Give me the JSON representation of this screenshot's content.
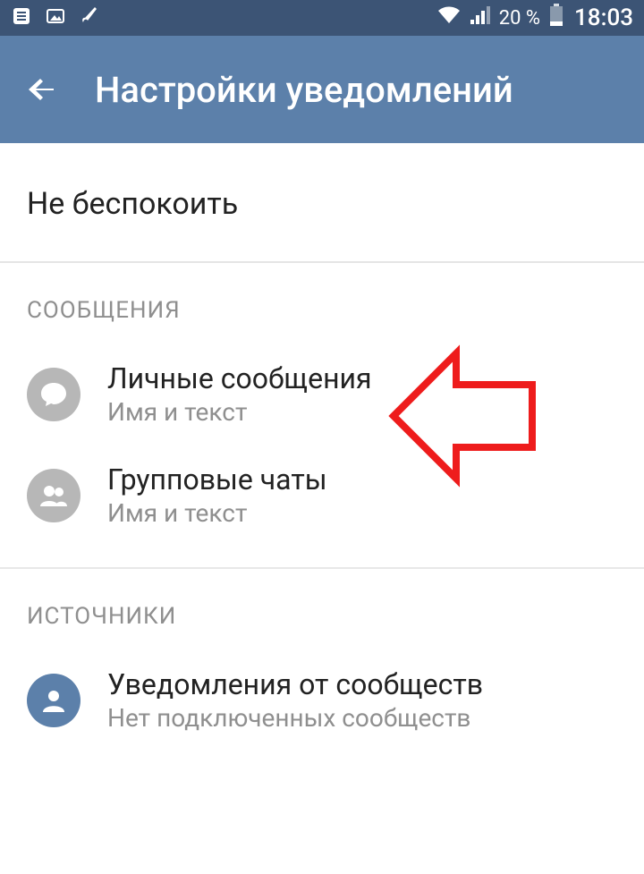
{
  "status": {
    "battery_pct": "20 %",
    "time": "18:03"
  },
  "appbar": {
    "title": "Настройки уведомлений"
  },
  "dnd": {
    "label": "Не беспокоить"
  },
  "messages": {
    "header": "СООБЩЕНИЯ",
    "items": [
      {
        "title": "Личные сообщения",
        "sub": "Имя и текст"
      },
      {
        "title": "Групповые чаты",
        "sub": "Имя и текст"
      }
    ]
  },
  "sources": {
    "header": "ИСТОЧНИКИ",
    "items": [
      {
        "title": "Уведомления от сообществ",
        "sub": "Нет подключенных сообществ"
      }
    ]
  }
}
